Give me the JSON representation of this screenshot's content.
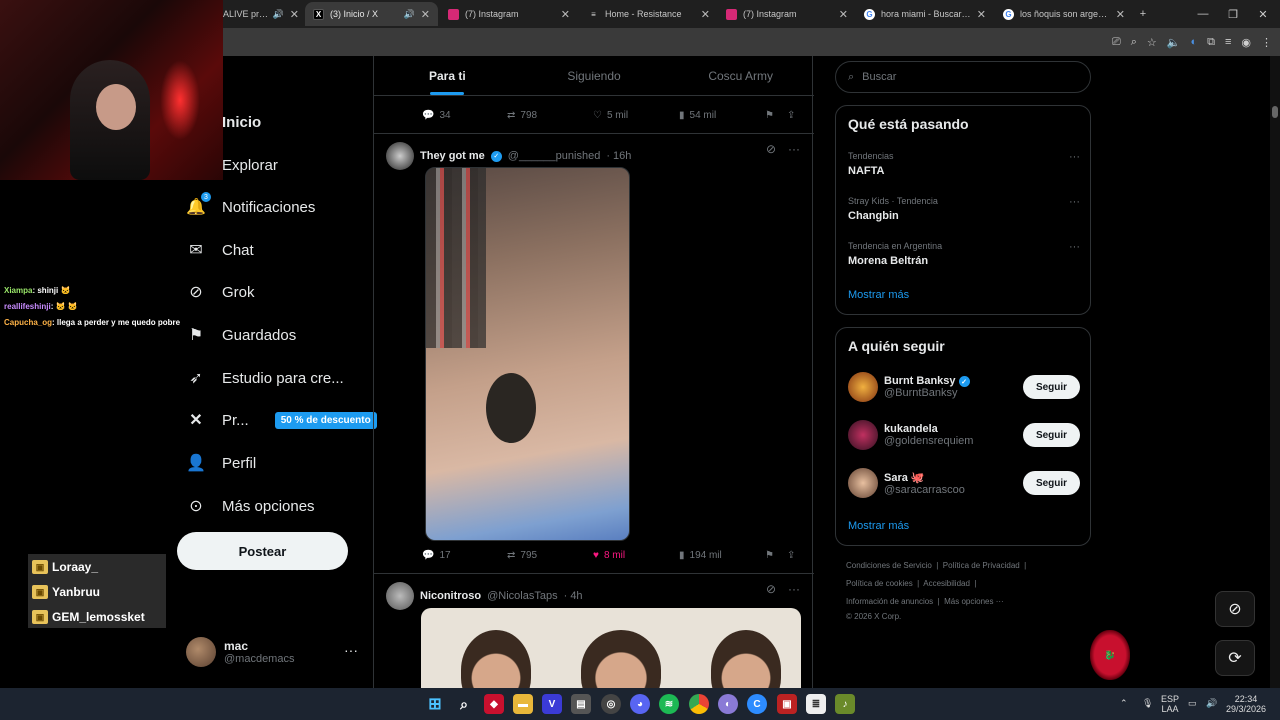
{
  "browser": {
    "tabs": [
      {
        "title": "ALIVE prese",
        "fav": "",
        "color": "#5a3db0"
      },
      {
        "title": "(3) Inicio / X",
        "fav": "X",
        "color": "#000000"
      },
      {
        "title": "(7) Instagram",
        "fav": "",
        "color": "#d62976"
      },
      {
        "title": "Home - Resistance",
        "fav": "≡",
        "color": "#333333"
      },
      {
        "title": "(7) Instagram",
        "fav": "",
        "color": "#d62976"
      },
      {
        "title": "hora miami - Buscar con",
        "fav": "G",
        "color": "#ffffff"
      },
      {
        "title": "los ñoquis son argentin",
        "fav": "G",
        "color": "#ffffff"
      }
    ]
  },
  "nav": {
    "items": [
      {
        "label": "Inicio",
        "icon": "home-icon"
      },
      {
        "label": "Explorar",
        "icon": "search-icon"
      },
      {
        "label": "Notificaciones",
        "icon": "bell-icon"
      },
      {
        "label": "Chat",
        "icon": "mail-icon"
      },
      {
        "label": "Grok",
        "icon": "grok-icon"
      },
      {
        "label": "Guardados",
        "icon": "bookmark-icon"
      },
      {
        "label": "Estudio para cre...",
        "icon": "rocket-icon"
      },
      {
        "label": "Pr...",
        "icon": "x-logo-icon"
      },
      {
        "label": "Perfil",
        "icon": "person-icon"
      },
      {
        "label": "Más opciones",
        "icon": "more-circle-icon"
      }
    ],
    "promo_badge": "50 % de descuento",
    "notif_count": "3",
    "post_label": "Postear",
    "account": {
      "name": "mac",
      "handle": "@macdemacs"
    }
  },
  "stream_chat": [
    {
      "user": "Xiampa",
      "msg": ": shinji 🐱"
    },
    {
      "user": "reallifeshinji",
      "msg": ": 🐱 🐱"
    },
    {
      "user": "Capucha_og",
      "msg": ": llega a perder y me quedo pobre"
    }
  ],
  "subs": [
    "Loraay_",
    "Yanbruu",
    "GEM_lemossket"
  ],
  "feed": {
    "tabs": [
      "Para ti",
      "Siguiendo",
      "Coscu Army"
    ],
    "prev_actions": {
      "replies": "34",
      "reposts": "798",
      "likes": "5 mil",
      "views": "54 mil"
    },
    "tweet1": {
      "name": "They got me",
      "handle": "@______punished",
      "time": "· 16h",
      "replies": "17",
      "reposts": "795",
      "likes": "8 mil",
      "views": "194 mil"
    },
    "tweet2": {
      "name": "Niconitroso",
      "handle": "@NicolasTaps",
      "time": "· 4h"
    }
  },
  "right": {
    "search_placeholder": "Buscar",
    "trends_title": "Qué está pasando",
    "trends": [
      {
        "meta": "Tendencias",
        "name": "NAFTA"
      },
      {
        "meta": "Stray Kids · Tendencia",
        "name": "Changbin"
      },
      {
        "meta": "Tendencia en Argentina",
        "name": "Morena Beltrán"
      }
    ],
    "show_more": "Mostrar más",
    "follow_title": "A quién seguir",
    "follow": [
      {
        "name": "Burnt Banksy",
        "handle": "@BurntBanksy",
        "btn": "Seguir"
      },
      {
        "name": "kukandela",
        "handle": "@goldensrequiem",
        "btn": "Seguir"
      },
      {
        "name": "Sara 🐙",
        "handle": "@saracarrascoo",
        "btn": "Seguir"
      }
    ],
    "footer": {
      "line1a": "Condiciones de Servicio",
      "line1b": "Política de Privacidad",
      "line2a": "Política de cookies",
      "line2b": "Accesibilidad",
      "line3a": "Información de anuncios",
      "line3b": "Más opciones ···",
      "copyright": "© 2026 X Corp."
    }
  },
  "taskbar": {
    "lang1": "ESP",
    "lang2": "LAA",
    "time": "22:34",
    "date": "29/3/2026"
  }
}
